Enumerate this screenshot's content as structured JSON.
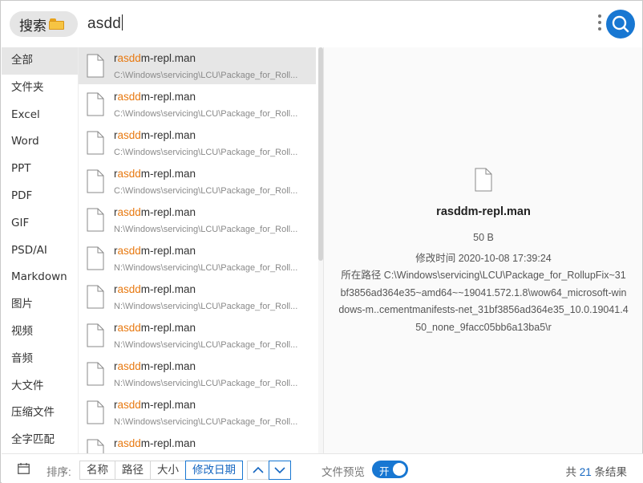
{
  "search": {
    "scope_label": "搜索",
    "query": "asdd"
  },
  "sidebar": {
    "items": [
      {
        "label": "全部",
        "active": true
      },
      {
        "label": "文件夹"
      },
      {
        "label": "Excel"
      },
      {
        "label": "Word"
      },
      {
        "label": "PPT"
      },
      {
        "label": "PDF"
      },
      {
        "label": "GIF"
      },
      {
        "label": "PSD/AI"
      },
      {
        "label": "Markdown"
      },
      {
        "label": "图片"
      },
      {
        "label": "视频"
      },
      {
        "label": "音频"
      },
      {
        "label": "大文件"
      },
      {
        "label": "压缩文件"
      },
      {
        "label": "全字匹配"
      }
    ]
  },
  "results": [
    {
      "name_pre": "r",
      "name_hl": "asdd",
      "name_post": "m-repl.man",
      "path": "C:\\Windows\\servicing\\LCU\\Package_for_Roll..."
    },
    {
      "name_pre": "r",
      "name_hl": "asdd",
      "name_post": "m-repl.man",
      "path": "C:\\Windows\\servicing\\LCU\\Package_for_Roll..."
    },
    {
      "name_pre": "r",
      "name_hl": "asdd",
      "name_post": "m-repl.man",
      "path": "C:\\Windows\\servicing\\LCU\\Package_for_Roll..."
    },
    {
      "name_pre": "r",
      "name_hl": "asdd",
      "name_post": "m-repl.man",
      "path": "C:\\Windows\\servicing\\LCU\\Package_for_Roll..."
    },
    {
      "name_pre": "r",
      "name_hl": "asdd",
      "name_post": "m-repl.man",
      "path": "N:\\Windows\\servicing\\LCU\\Package_for_Roll..."
    },
    {
      "name_pre": "r",
      "name_hl": "asdd",
      "name_post": "m-repl.man",
      "path": "N:\\Windows\\servicing\\LCU\\Package_for_Roll..."
    },
    {
      "name_pre": "r",
      "name_hl": "asdd",
      "name_post": "m-repl.man",
      "path": "N:\\Windows\\servicing\\LCU\\Package_for_Roll..."
    },
    {
      "name_pre": "r",
      "name_hl": "asdd",
      "name_post": "m-repl.man",
      "path": "N:\\Windows\\servicing\\LCU\\Package_for_Roll..."
    },
    {
      "name_pre": "r",
      "name_hl": "asdd",
      "name_post": "m-repl.man",
      "path": "N:\\Windows\\servicing\\LCU\\Package_for_Roll..."
    },
    {
      "name_pre": "r",
      "name_hl": "asdd",
      "name_post": "m-repl.man",
      "path": "N:\\Windows\\servicing\\LCU\\Package_for_Roll..."
    },
    {
      "name_pre": "r",
      "name_hl": "asdd",
      "name_post": "m-repl.man",
      "path": ""
    }
  ],
  "preview": {
    "name": "rasddm-repl.man",
    "size": "50 B",
    "modified": "修改时间 2020-10-08 17:39:24",
    "path": "所在路径 C:\\Windows\\servicing\\LCU\\Package_for_RollupFix~31bf3856ad364e35~amd64~~19041.572.1.8\\wow64_microsoft-windows-m..cementmanifests-net_31bf3856ad364e35_10.0.19041.450_none_9facc05bb6a13ba5\\r"
  },
  "bottombar": {
    "sort_label": "排序:",
    "sort_options": [
      "名称",
      "路径",
      "大小",
      "修改日期"
    ],
    "active_sort": "修改日期",
    "preview_label": "文件预览",
    "toggle_label": "开",
    "count_prefix": "共",
    "count": "21",
    "count_suffix": "条结果"
  },
  "icons": {
    "scope": "folder-icon",
    "menu": "more-vertical-icon",
    "search": "search-icon",
    "file": "document-icon",
    "calendar": "calendar-icon",
    "ascending": "chevron-up-icon",
    "descending": "chevron-down-icon"
  },
  "colors": {
    "accent": "#1877d2",
    "highlight": "#e87a12"
  }
}
